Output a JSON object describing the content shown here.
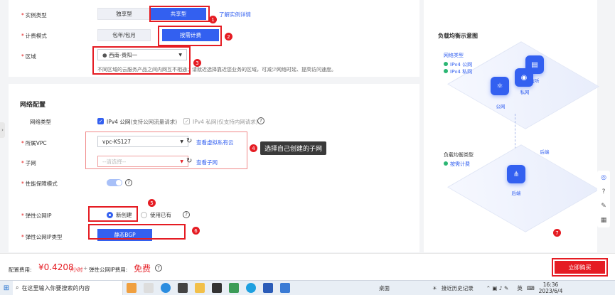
{
  "form": {
    "instance_type": {
      "label": "实例类型",
      "options": [
        "独享型",
        "共享型"
      ],
      "active": 1,
      "link": "了解实例详情"
    },
    "billing": {
      "label": "计费模式",
      "options": [
        "包年/包月",
        "按需计费"
      ],
      "active": 1
    },
    "region": {
      "label": "区域",
      "value": "西南-贵阳一",
      "hint": "不同区域的云服务产品之间内网互不相通；请就近选择靠近您业务的区域，可减少网络时延、提高访问速度。"
    },
    "network": {
      "section_title": "网络配置",
      "net_type_label": "网络类型",
      "ipv4_label": "IPv4 公网",
      "ipv4_note": "(支持公网流量请求)",
      "ipv4_private_label": "IPv4 私网",
      "ipv4_private_note": "(仅支持内网请求)",
      "vpc_label": "所属VPC",
      "vpc_value": "vpc-KS127",
      "vpc_link": "查看虚拟私有云",
      "subnet_label": "子网",
      "subnet_placeholder": "--请选择--",
      "subnet_link": "查看子网",
      "perf_label": "性能保障模式",
      "eip_label": "弹性公网IP",
      "eip_new": "新创建",
      "eip_existing": "使用已有",
      "eip_type_label": "弹性公网IP类型",
      "eip_type_value": "静态BGP"
    }
  },
  "tooltip": {
    "text": "选择自己创建的子网"
  },
  "annotations": [
    "1",
    "2",
    "3",
    "4",
    "5",
    "6",
    "7"
  ],
  "diagram": {
    "title": "负载均衡示意图",
    "net_type_title": "网络类型",
    "net_items": [
      "IPv4 公网",
      "IPv4 私网"
    ],
    "node_public": "公网",
    "node_private": "私网",
    "node_top": "监听",
    "lb_title": "负载均衡类型",
    "lb_items": [
      "按需计费"
    ],
    "node_backend": "后端",
    "node_backend_top": "后端"
  },
  "bottom": {
    "fee_label": "配置费用:",
    "price": "¥0.4208",
    "unit": "/小时",
    "plus": "+",
    "eip_fee_label": "弹性公网IP费用:",
    "eip_fee": "免费",
    "buy_label": "立即购买"
  },
  "taskbar": {
    "search_placeholder": "在这里输入你要搜索的内容",
    "desktop_label": "桌面",
    "history_label": "接近历史记录",
    "lang": "英",
    "time": "16:36",
    "date": "2023/6/4"
  },
  "colors": {
    "primary": "#3360f0",
    "danger": "#e51c23"
  }
}
